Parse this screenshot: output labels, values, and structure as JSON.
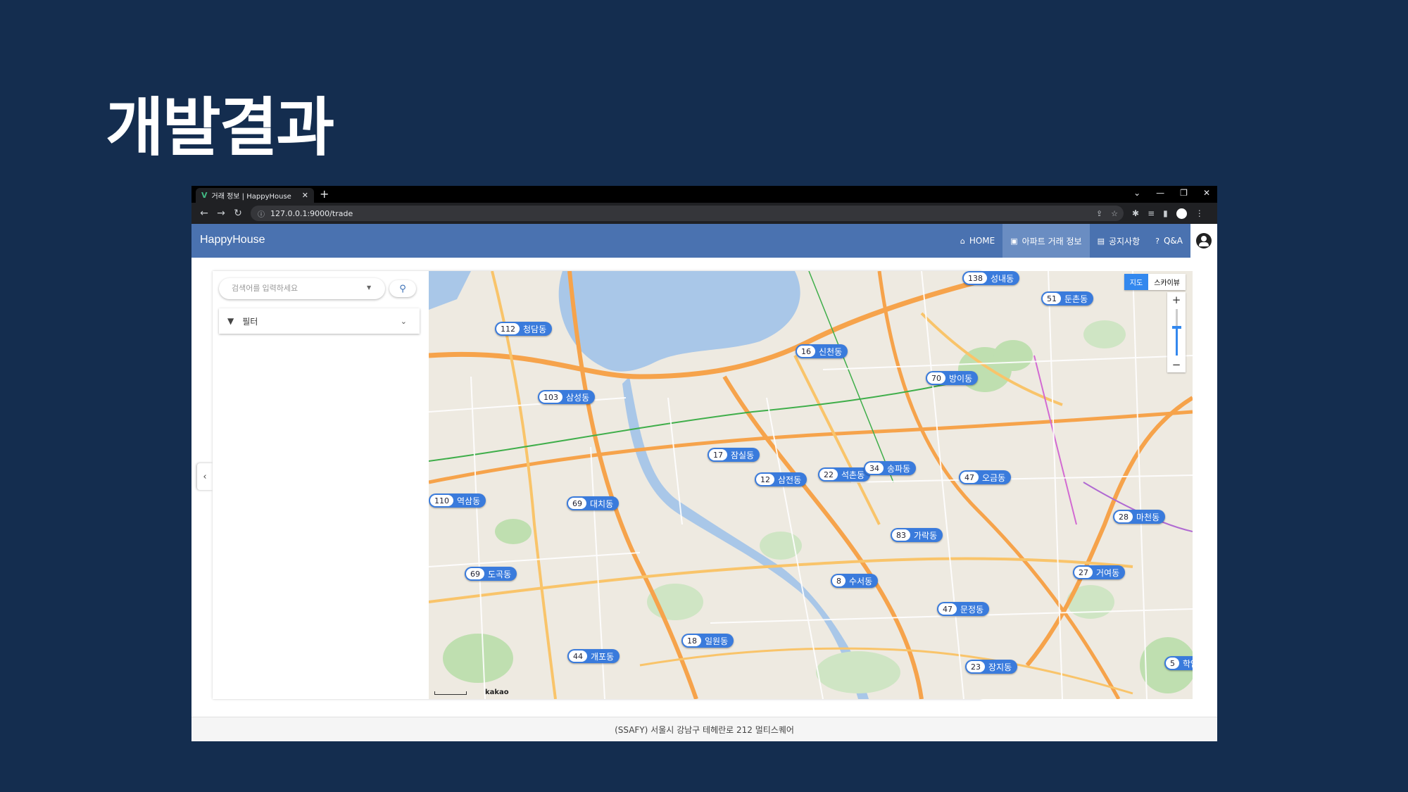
{
  "slide": {
    "title": "개발결과"
  },
  "browser": {
    "tab_title": "거래 정보 | HappyHouse",
    "new_tab": "+",
    "url": "127.0.0.1:9000/trade"
  },
  "app": {
    "brand": "HappyHouse",
    "nav": [
      {
        "label": "HOME",
        "icon": "home-icon",
        "active": false
      },
      {
        "label": "아파트 거래 정보",
        "icon": "building-icon",
        "active": true
      },
      {
        "label": "공지사항",
        "icon": "clipboard-icon",
        "active": false
      },
      {
        "label": "Q&A",
        "icon": "question-icon",
        "active": false
      }
    ],
    "account_icon": "account-circle-icon"
  },
  "search": {
    "placeholder": "검색어를 입력하세요"
  },
  "filter": {
    "label": "필터"
  },
  "map": {
    "type_options": [
      "지도",
      "스카이뷰"
    ],
    "selected_type": "지도",
    "zoom_in": "+",
    "zoom_out": "−",
    "zoom_level_fraction": 0.6,
    "logo": "kakao",
    "markers": [
      {
        "count": "138",
        "name": "성내동"
      },
      {
        "count": "51",
        "name": "둔촌동"
      },
      {
        "count": "112",
        "name": "청담동"
      },
      {
        "count": "16",
        "name": "신천동"
      },
      {
        "count": "70",
        "name": "방이동"
      },
      {
        "count": "103",
        "name": "삼성동"
      },
      {
        "count": "17",
        "name": "잠실동"
      },
      {
        "count": "12",
        "name": "삼전동"
      },
      {
        "count": "22",
        "name": "석촌동"
      },
      {
        "count": "34",
        "name": "송파동"
      },
      {
        "count": "47",
        "name": "오금동"
      },
      {
        "count": "110",
        "name": "역삼동"
      },
      {
        "count": "69",
        "name": "대치동"
      },
      {
        "count": "28",
        "name": "마천동"
      },
      {
        "count": "83",
        "name": "가락동"
      },
      {
        "count": "69",
        "name": "도곡동"
      },
      {
        "count": "27",
        "name": "거여동"
      },
      {
        "count": "8",
        "name": "수서동"
      },
      {
        "count": "47",
        "name": "문정동"
      },
      {
        "count": "18",
        "name": "일원동"
      },
      {
        "count": "44",
        "name": "개포동"
      },
      {
        "count": "23",
        "name": "장지동"
      },
      {
        "count": "5",
        "name": "학암"
      }
    ]
  },
  "footer": {
    "text": "(SSAFY) 서울시 강남구 테헤란로 212 멀티스퀘어"
  },
  "colors": {
    "header": "#4a72b0",
    "marker": "#3a7bdc",
    "slide_bg": "#142d4f"
  }
}
